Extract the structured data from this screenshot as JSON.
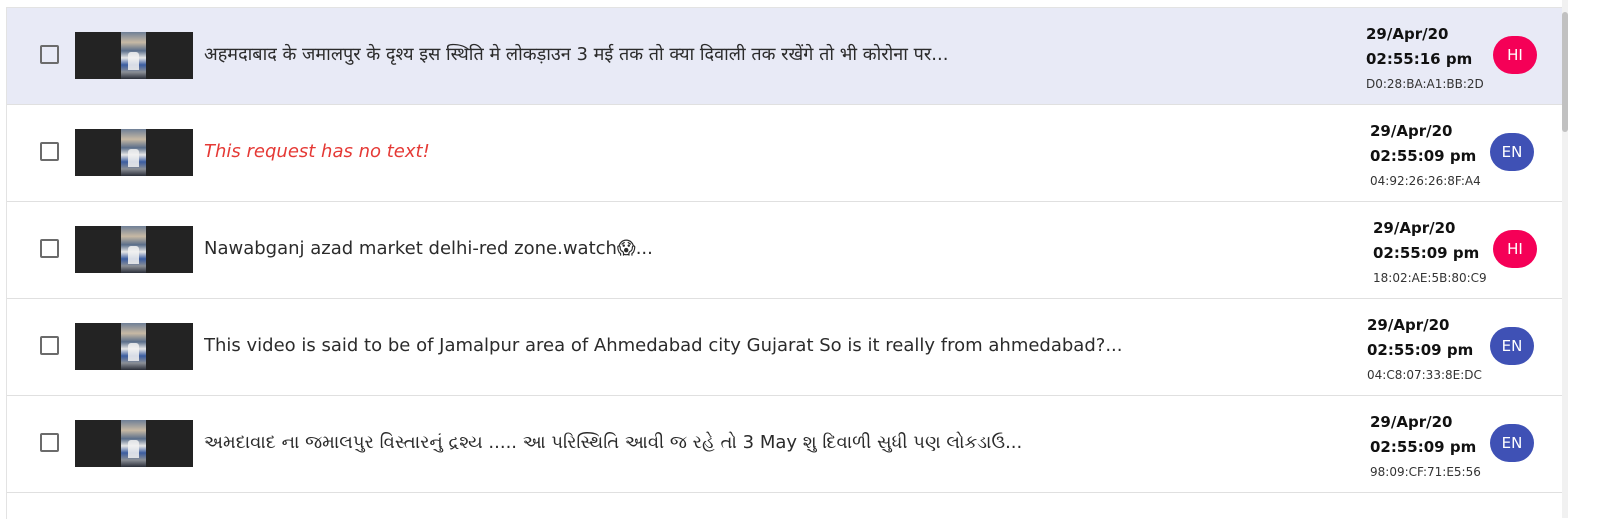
{
  "colors": {
    "selected_row_bg": "#e8eaf6",
    "no_text_color": "#e53935",
    "badge_hi": "#f50057",
    "badge_en": "#3f51b5"
  },
  "rows": [
    {
      "selected": true,
      "checked": false,
      "message": "अहमदाबाद के जमालपुर के दृश्य इस स्थिति मे लोकड़ाउन 3 मई तक तो क्या दिवाली तक रखेंगे तो भी कोरोना पर...",
      "no_text": false,
      "date": "29/Apr/20",
      "time": "02:55:16 pm",
      "mac": "D0:28:BA:A1:BB:2D",
      "lang": "HI"
    },
    {
      "selected": false,
      "checked": false,
      "message": "This request has no text!",
      "no_text": true,
      "date": "29/Apr/20",
      "time": "02:55:09 pm",
      "mac": "04:92:26:26:8F:A4",
      "lang": "EN"
    },
    {
      "selected": false,
      "checked": false,
      "message": "Nawabganj azad market delhi-red zone.watch😱...",
      "no_text": false,
      "date": "29/Apr/20",
      "time": "02:55:09 pm",
      "mac": "18:02:AE:5B:80:C9",
      "lang": "HI"
    },
    {
      "selected": false,
      "checked": false,
      "message": "This video is said to be of Jamalpur area of Ahmedabad city Gujarat So is it really from ahmedabad?...",
      "no_text": false,
      "date": "29/Apr/20",
      "time": "02:55:09 pm",
      "mac": "04:C8:07:33:8E:DC",
      "lang": "EN"
    },
    {
      "selected": false,
      "checked": false,
      "message": "અમદાવાદ ના જમાલપુર વિસ્તારનું દ્રશ્ય ..... આ પરિસ્થિતિ આવી જ રહે તો 3 May શુ દિવાળી સુધી પણ લોકડાઉ...",
      "no_text": false,
      "date": "29/Apr/20",
      "time": "02:55:09 pm",
      "mac": "98:09:CF:71:E5:56",
      "lang": "EN"
    }
  ]
}
